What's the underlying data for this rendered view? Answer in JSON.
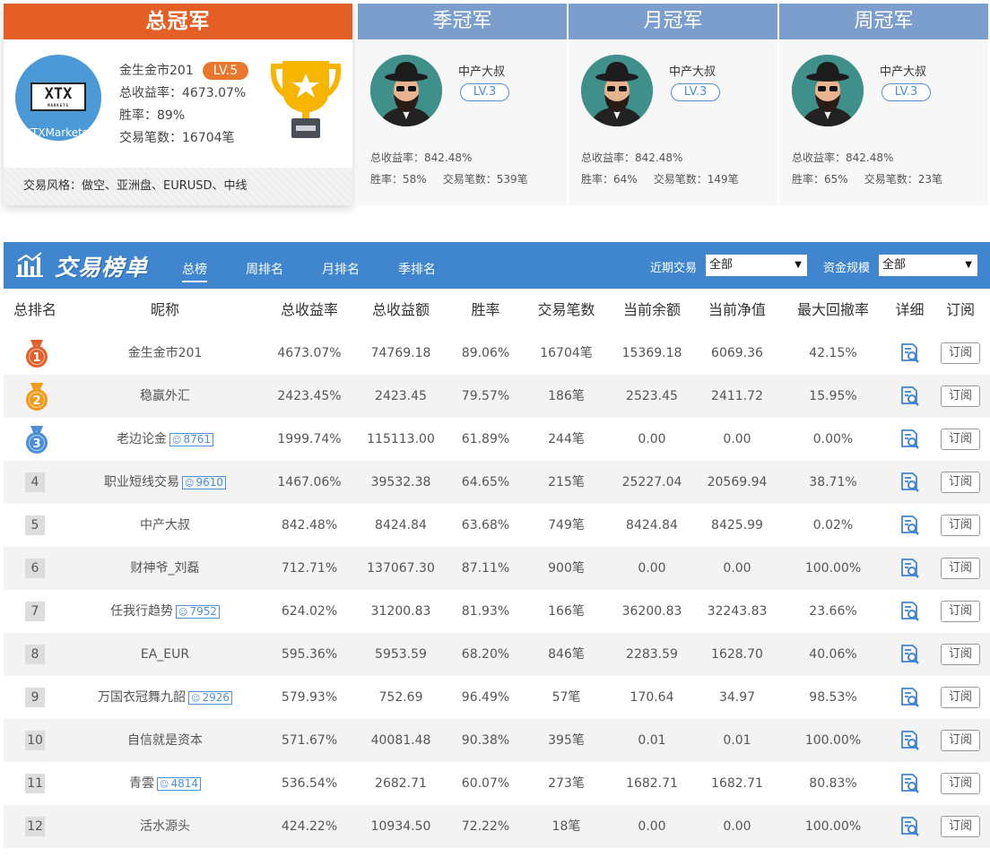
{
  "overall": {
    "title": "总冠军",
    "logo_text": "XTX",
    "logo_sub": "MARKETS",
    "logo_caption": "XTXMarkets",
    "name": "金生金市201",
    "level": "LV.5",
    "return_line": "总收益率：4673.07%",
    "winrate_line": "胜率：89%",
    "trades_line": "交易笔数：16704笔",
    "style_line": "交易风格：做空、亚洲盘、EURUSD、中线"
  },
  "champions": [
    {
      "title": "季冠军",
      "name": "中产大叔",
      "level": "LV.3",
      "return_line": "总收益率：842.48%",
      "winrate_line": "胜率：58%",
      "trades_line": "交易笔数：539笔"
    },
    {
      "title": "月冠军",
      "name": "中产大叔",
      "level": "LV.3",
      "return_line": "总收益率：842.48%",
      "winrate_line": "胜率：64%",
      "trades_line": "交易笔数：149笔"
    },
    {
      "title": "周冠军",
      "name": "中产大叔",
      "level": "LV.3",
      "return_line": "总收益率：842.48%",
      "winrate_line": "胜率：65%",
      "trades_line": "交易笔数：23笔"
    }
  ],
  "board": {
    "title": "交易榜单",
    "tabs": [
      "总榜",
      "周排名",
      "月排名",
      "季排名"
    ],
    "filter_recent_label": "近期交易",
    "filter_recent_value": "全部",
    "filter_capital_label": "资金规模",
    "filter_capital_value": "全部"
  },
  "columns": [
    "总排名",
    "昵称",
    "总收益率",
    "总收益额",
    "胜率",
    "交易笔数",
    "当前余额",
    "当前净值",
    "最大回撤率",
    "详细",
    "订阅"
  ],
  "subscribe_label": "订阅",
  "rows": [
    {
      "rank": "1",
      "name": "金生金市201",
      "fans": "",
      "ret": "4673.07%",
      "profit": "74769.18",
      "win": "89.06%",
      "trades": "16704笔",
      "balance": "15369.18",
      "equity": "6069.36",
      "dd": "42.15%"
    },
    {
      "rank": "2",
      "name": "稳赢外汇",
      "fans": "",
      "ret": "2423.45%",
      "profit": "2423.45",
      "win": "79.57%",
      "trades": "186笔",
      "balance": "2523.45",
      "equity": "2411.72",
      "dd": "15.95%"
    },
    {
      "rank": "3",
      "name": "老边论金",
      "fans": "8761",
      "ret": "1999.74%",
      "profit": "115113.00",
      "win": "61.89%",
      "trades": "244笔",
      "balance": "0.00",
      "equity": "0.00",
      "dd": "0.00%"
    },
    {
      "rank": "4",
      "name": "职业短线交易",
      "fans": "9610",
      "ret": "1467.06%",
      "profit": "39532.38",
      "win": "64.65%",
      "trades": "215笔",
      "balance": "25227.04",
      "equity": "20569.94",
      "dd": "38.71%"
    },
    {
      "rank": "5",
      "name": "中产大叔",
      "fans": "",
      "ret": "842.48%",
      "profit": "8424.84",
      "win": "63.68%",
      "trades": "749笔",
      "balance": "8424.84",
      "equity": "8425.99",
      "dd": "0.02%"
    },
    {
      "rank": "6",
      "name": "财神爷_刘磊",
      "fans": "",
      "ret": "712.71%",
      "profit": "137067.30",
      "win": "87.11%",
      "trades": "900笔",
      "balance": "0.00",
      "equity": "0.00",
      "dd": "100.00%"
    },
    {
      "rank": "7",
      "name": "任我行趋势",
      "fans": "7952",
      "ret": "624.02%",
      "profit": "31200.83",
      "win": "81.93%",
      "trades": "166笔",
      "balance": "36200.83",
      "equity": "32243.83",
      "dd": "23.66%"
    },
    {
      "rank": "8",
      "name": "EA_EUR",
      "fans": "",
      "ret": "595.36%",
      "profit": "5953.59",
      "win": "68.20%",
      "trades": "846笔",
      "balance": "2283.59",
      "equity": "1628.70",
      "dd": "40.06%"
    },
    {
      "rank": "9",
      "name": "万国衣冠舞九韶",
      "fans": "2926",
      "ret": "579.93%",
      "profit": "752.69",
      "win": "96.49%",
      "trades": "57笔",
      "balance": "170.64",
      "equity": "34.97",
      "dd": "98.53%"
    },
    {
      "rank": "10",
      "name": "自信就是资本",
      "fans": "",
      "ret": "571.67%",
      "profit": "40081.48",
      "win": "90.38%",
      "trades": "395笔",
      "balance": "0.01",
      "equity": "0.01",
      "dd": "100.00%"
    },
    {
      "rank": "11",
      "name": "青雲",
      "fans": "4814",
      "ret": "536.54%",
      "profit": "2682.71",
      "win": "60.07%",
      "trades": "273笔",
      "balance": "1682.71",
      "equity": "1682.71",
      "dd": "80.83%"
    },
    {
      "rank": "12",
      "name": "活水源头",
      "fans": "",
      "ret": "424.22%",
      "profit": "10934.50",
      "win": "72.22%",
      "trades": "18笔",
      "balance": "0.00",
      "equity": "0.00",
      "dd": "100.00%"
    }
  ],
  "colors": {
    "overall_header": "#e35f26",
    "champ_header": "#7b9ecc",
    "board_bar": "#3f86cf",
    "accent_blue": "#4d8fd4",
    "medal_gold": "#f29a1a",
    "medal_orange": "#e0622a",
    "medal_blue": "#4a8fd8"
  }
}
